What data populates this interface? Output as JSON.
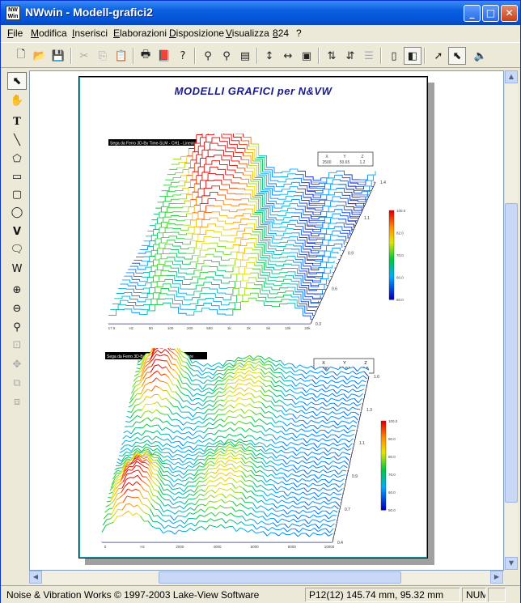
{
  "window": {
    "title": "NWwin - Modell-grafici2",
    "icon_label": "NW\nWin"
  },
  "menu": [
    "File",
    "Modifica",
    "Inserisci",
    "Elaborazioni",
    "Disposizione",
    "Visualizza",
    "824",
    "?"
  ],
  "page": {
    "title": "MODELLI GRAFICI per N&VW"
  },
  "chart_top": {
    "caption": "Sega da Ferro 3D-By Time-SLM - CH1 - Lineare",
    "readout_headers": [
      "X",
      "Y",
      "Z"
    ],
    "readout_values": [
      "2500",
      "50.65",
      "1.2"
    ],
    "x_ticks": [
      "17.5",
      "Hz",
      "50",
      "100",
      "200",
      "500",
      "1k",
      "2k",
      "5k",
      "10k",
      "20k"
    ],
    "z_ticks": [
      "1.4",
      "1.1",
      "0.9",
      "0.6",
      "0.3"
    ],
    "colorbar": [
      "100.0",
      "82.0",
      "70.0",
      "60.0",
      "50.0"
    ]
  },
  "chart_bottom": {
    "caption": "Sega da Ferro 3D-By Time-SLM - CH1 - Lineare",
    "readout_headers": [
      "X",
      "Y",
      "Z"
    ],
    "readout_values": [
      "1700",
      "86.97",
      "0.5"
    ],
    "x_ticks": [
      "0",
      "Hz",
      "2000",
      "4000",
      "6000",
      "8000",
      "10000"
    ],
    "z_ticks": [
      "1.6",
      "1.3",
      "1.1",
      "0.9",
      "0.7",
      "0.4"
    ],
    "colorbar": [
      "100.0",
      "90.0",
      "80.0",
      "70.0",
      "60.0",
      "50.0"
    ]
  },
  "status": {
    "left": "Noise & Vibration Works © 1997-2003 Lake-View Software",
    "coords": "P12(12) 145.74 mm, 95.32 mm",
    "num": "NUM"
  }
}
